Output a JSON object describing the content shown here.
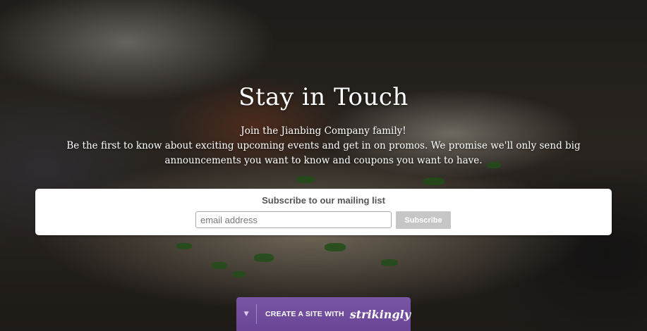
{
  "hero": {
    "title": "Stay in Touch",
    "tagline_line1": "Join the Jianbing Company family!",
    "tagline_line2": "Be the first to know about exciting upcoming events and get in on promos. We promise we'll only send big announcements you want to know and coupons you want to have."
  },
  "signup": {
    "title": "Subscribe to our mailing list",
    "email_placeholder": "email address",
    "email_value": "",
    "button_label": "Subscribe"
  },
  "strikingly_bar": {
    "caret_icon": "triangle-down-icon",
    "caret_glyph": "▼",
    "label": "CREATE A SITE WITH",
    "brand": "strikingly",
    "color": "#6e4a9b"
  },
  "colors": {
    "button_bg": "#c6c6c6",
    "signup_title": "#555555"
  }
}
